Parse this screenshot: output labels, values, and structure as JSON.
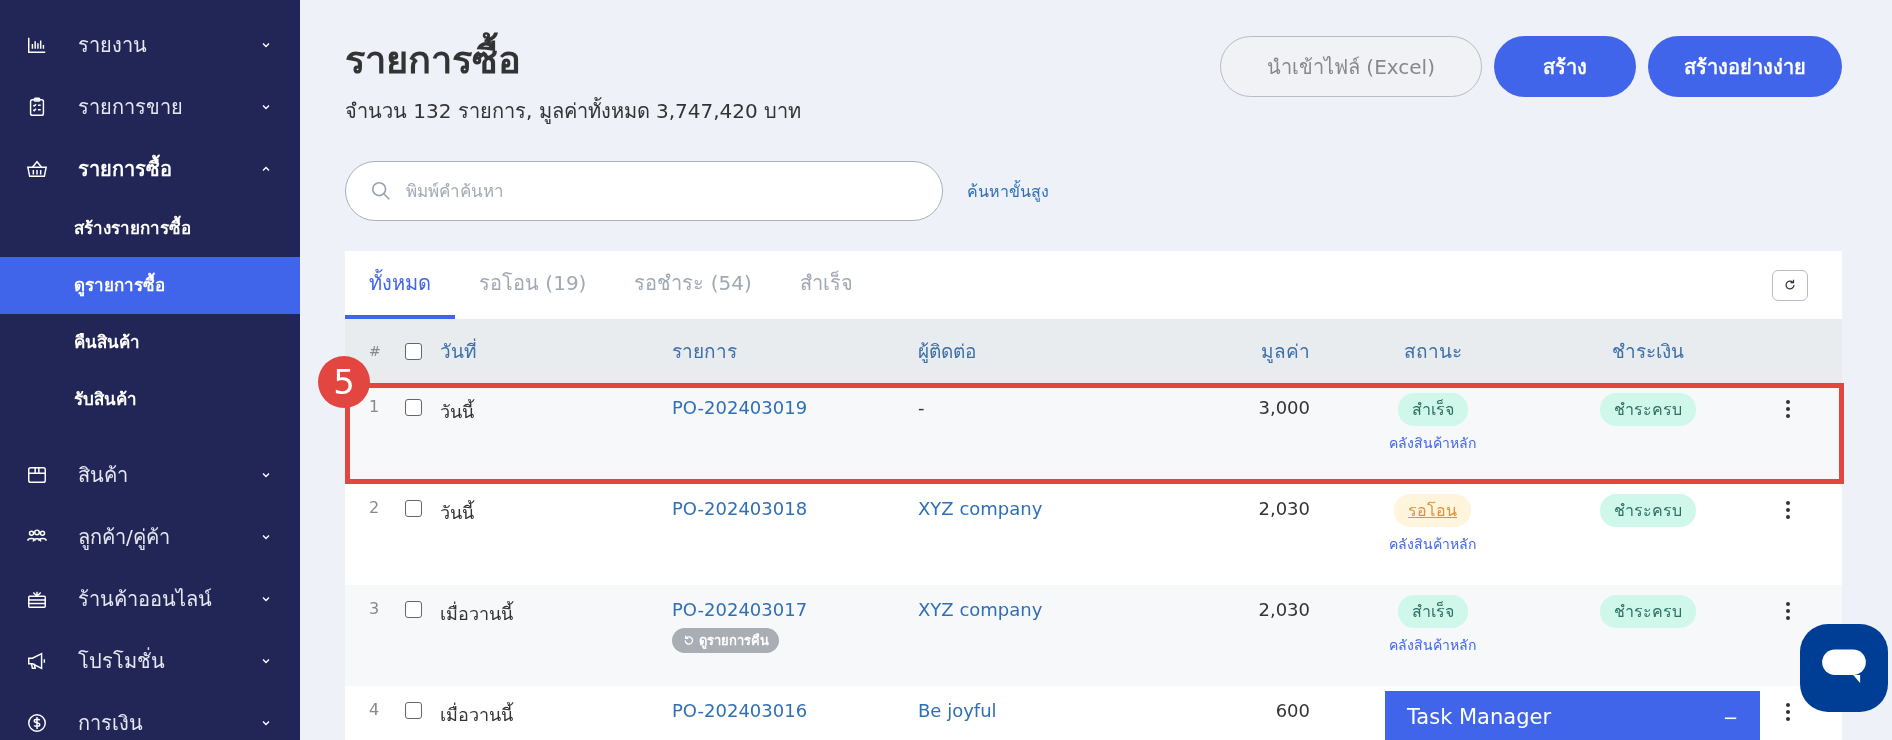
{
  "sidebar": {
    "items": [
      {
        "label": "รายงาน",
        "expanded": false
      },
      {
        "label": "รายการขาย",
        "expanded": false
      },
      {
        "label": "รายการซื้อ",
        "expanded": true,
        "children": [
          {
            "label": "สร้างรายการซื้อ",
            "selected": false
          },
          {
            "label": "ดูรายการซื้อ",
            "selected": true
          },
          {
            "label": "คืนสินค้า",
            "selected": false
          },
          {
            "label": "รับสินค้า",
            "selected": false
          }
        ]
      },
      {
        "label": "สินค้า",
        "expanded": false
      },
      {
        "label": "ลูกค้า/คู่ค้า",
        "expanded": false
      },
      {
        "label": "ร้านค้าออนไลน์",
        "expanded": false
      },
      {
        "label": "โปรโมชั่น",
        "expanded": false
      },
      {
        "label": "การเงิน",
        "expanded": false
      }
    ]
  },
  "header": {
    "title": "รายการซื้อ",
    "summary": "จำนวน 132 รายการ, มูลค่าทั้งหมด 3,747,420 บาท",
    "buttons": [
      {
        "label": "นำเข้าไฟล์ (Excel)",
        "kind": "outline"
      },
      {
        "label": "สร้าง",
        "kind": "primary"
      },
      {
        "label": "สร้างอย่างง่าย",
        "kind": "primary"
      }
    ]
  },
  "search": {
    "placeholder": "พิมพ์คำค้นหา",
    "advanced_link": "ค้นหาขั้นสูง"
  },
  "tabs": [
    {
      "label": "ทั้งหมด",
      "selected": true
    },
    {
      "label": "รอโอน (19)",
      "selected": false
    },
    {
      "label": "รอชำระ (54)",
      "selected": false
    },
    {
      "label": "สำเร็จ",
      "selected": false
    }
  ],
  "table": {
    "columns": [
      "#",
      "วันที่",
      "รายการ",
      "ผู้ติดต่อ",
      "มูลค่า",
      "สถานะ",
      "ชำระเงิน"
    ],
    "select_all_checked": false,
    "rows": [
      {
        "number": "1",
        "checked": false,
        "date": "วันนี้",
        "order": "PO-202403019",
        "contact": "-",
        "contact_linked": false,
        "value": "3,000",
        "status": {
          "label": "สำเร็จ",
          "kind": "done"
        },
        "warehouse": "คลังสินค้าหลัก",
        "payment": "ชำระครบ",
        "annotated": true
      },
      {
        "number": "2",
        "checked": false,
        "date": "วันนี้",
        "order": "PO-202403018",
        "contact": "XYZ company",
        "contact_linked": true,
        "value": "2,030",
        "status": {
          "label": "รอโอน",
          "kind": "pending"
        },
        "warehouse": "คลังสินค้าหลัก",
        "payment": "ชำระครบ",
        "annotated": false
      },
      {
        "number": "3",
        "checked": false,
        "date": "เมื่อวานนี้",
        "order": "PO-202403017",
        "return_link": "ดูรายการคืน",
        "contact": "XYZ company",
        "contact_linked": true,
        "value": "2,030",
        "status": {
          "label": "สำเร็จ",
          "kind": "done"
        },
        "warehouse": "คลังสินค้าหลัก",
        "payment": "ชำระครบ",
        "annotated": false
      },
      {
        "number": "4",
        "checked": false,
        "date": "เมื่อวานนี้",
        "order": "PO-202403016",
        "contact": "Be joyful",
        "contact_linked": true,
        "value": "600",
        "annotated": false
      }
    ]
  },
  "annotation": {
    "number": "5"
  },
  "task_manager": {
    "title": "Task Manager",
    "minimize": "−"
  }
}
